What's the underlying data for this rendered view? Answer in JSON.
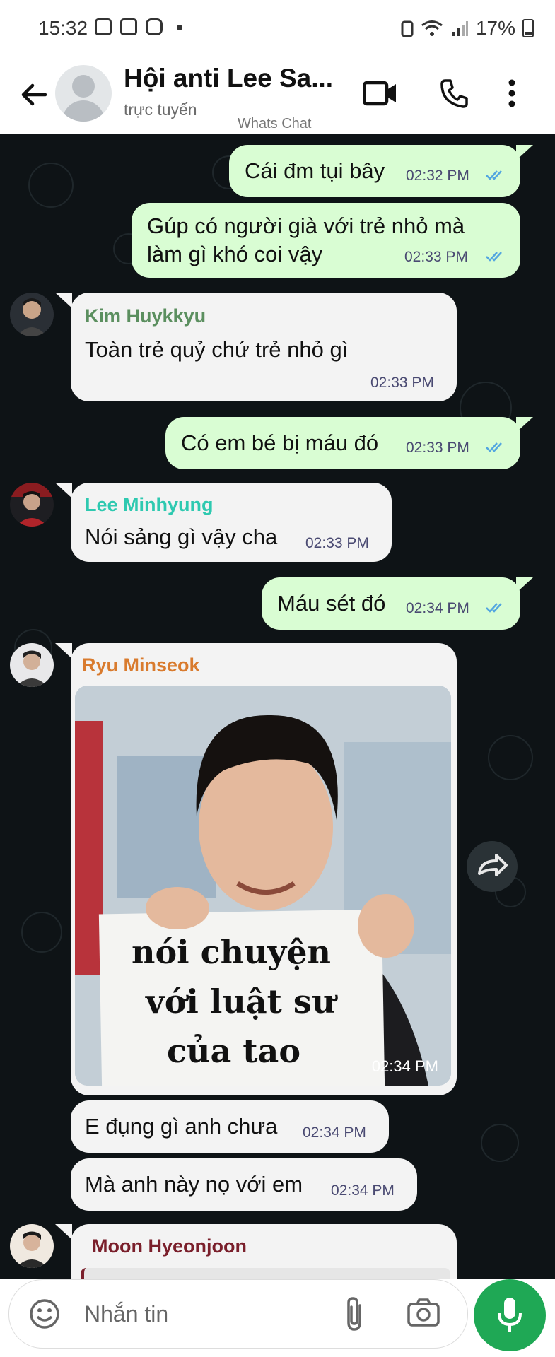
{
  "status_bar": {
    "time": "15:32",
    "battery": "17%"
  },
  "header": {
    "title": "Hội anti Lee Sa...",
    "status": "trực tuyến",
    "app_name": "Whats Chat"
  },
  "messages": [
    {
      "dir": "out",
      "text": "Cái đm tụi bây",
      "time": "02:32 PM"
    },
    {
      "dir": "out",
      "text_line1": "Gúp có người già với trẻ nhỏ mà",
      "text_line2": "làm gì khó coi vậy",
      "time": "02:33 PM"
    },
    {
      "dir": "in",
      "sender": "Kim Huykkyu",
      "text": "Toàn trẻ quỷ chứ trẻ nhỏ gì",
      "time": "02:33 PM"
    },
    {
      "dir": "out",
      "text": "Có em bé bị máu đó",
      "time": "02:33 PM"
    },
    {
      "dir": "in",
      "sender": "Lee Minhyung",
      "text": "Nói sảng gì vậy cha",
      "time": "02:33 PM"
    },
    {
      "dir": "out",
      "text": "Máu sét đó",
      "time": "02:34 PM"
    },
    {
      "dir": "in",
      "sender": "Ryu Minseok",
      "image_caption_line1": "nói chuyện",
      "image_caption_line2": "với luật sư",
      "image_caption_line3": "của tao",
      "time": "02:34 PM"
    },
    {
      "dir": "in",
      "text": "E đụng gì anh chưa",
      "time": "02:34 PM"
    },
    {
      "dir": "in",
      "text": "Mà anh này nọ với em",
      "time": "02:34 PM"
    },
    {
      "dir": "in",
      "sender": "Moon Hyeonjoon"
    }
  ],
  "composer": {
    "placeholder": "Nhắn tin"
  },
  "colors": {
    "accent": "#1fa855",
    "outgoing": "#d9fdd3",
    "incoming": "#f3f3f3",
    "kim": "#5b8f5f",
    "lee": "#2ec9b0",
    "ryu": "#d97b2e",
    "moon": "#7a1f2b"
  }
}
